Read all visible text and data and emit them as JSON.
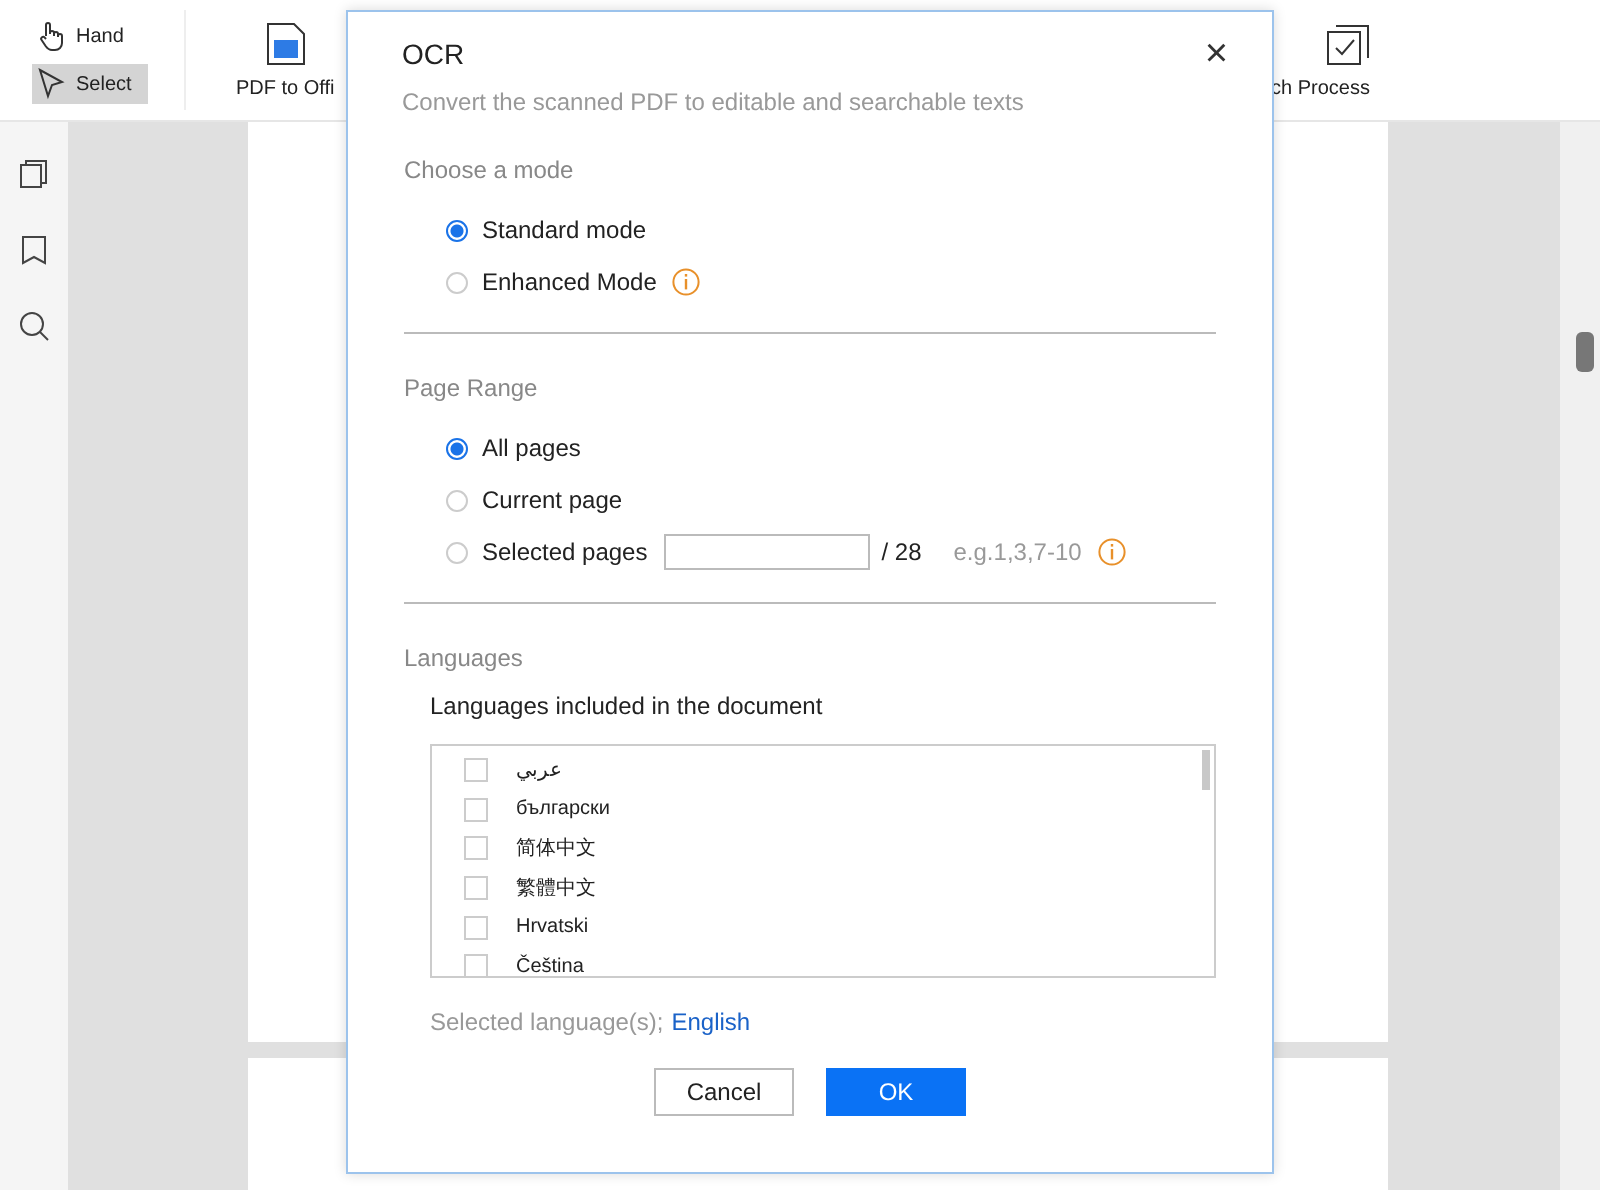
{
  "toolbar": {
    "tools": [
      {
        "label": "Hand",
        "selected": false
      },
      {
        "label": "Select",
        "selected": true
      }
    ],
    "buttons": [
      {
        "label": "PDF to Offi",
        "kind": "convert"
      },
      {
        "label": "ch Process",
        "kind": "batch"
      }
    ]
  },
  "sidebar": {
    "items": [
      {
        "kind": "pages"
      },
      {
        "kind": "bookmark"
      },
      {
        "kind": "search"
      }
    ]
  },
  "dialog": {
    "title": "OCR",
    "close": "×",
    "subtitle": "Convert the scanned PDF to editable and searchable texts",
    "mode": {
      "heading": "Choose a mode",
      "options": [
        {
          "label": "Standard mode",
          "selected": true,
          "info": false
        },
        {
          "label": "Enhanced Mode",
          "selected": false,
          "info": true
        }
      ]
    },
    "page_range": {
      "heading": "Page Range",
      "options": [
        {
          "label": "All pages",
          "selected": true,
          "kind": "plain"
        },
        {
          "label": "Current page",
          "selected": false,
          "kind": "plain"
        },
        {
          "label": "Selected pages",
          "selected": false,
          "kind": "range"
        }
      ],
      "total": "/ 28",
      "hint": "e.g.1,3,7-10"
    },
    "languages": {
      "heading": "Languages",
      "label": "Languages included in the document",
      "items": [
        {
          "label": "عربي",
          "checked": false
        },
        {
          "label": "български",
          "checked": false
        },
        {
          "label": "简体中文",
          "checked": false
        },
        {
          "label": "繁體中文",
          "checked": false
        },
        {
          "label": "Hrvatski",
          "checked": false
        },
        {
          "label": "Čeština",
          "checked": false
        }
      ],
      "selected_label": "Selected language(s);",
      "selected_value": "English"
    },
    "buttons": [
      {
        "label": "Cancel",
        "kind": "secondary"
      },
      {
        "label": "OK",
        "kind": "primary"
      }
    ]
  }
}
